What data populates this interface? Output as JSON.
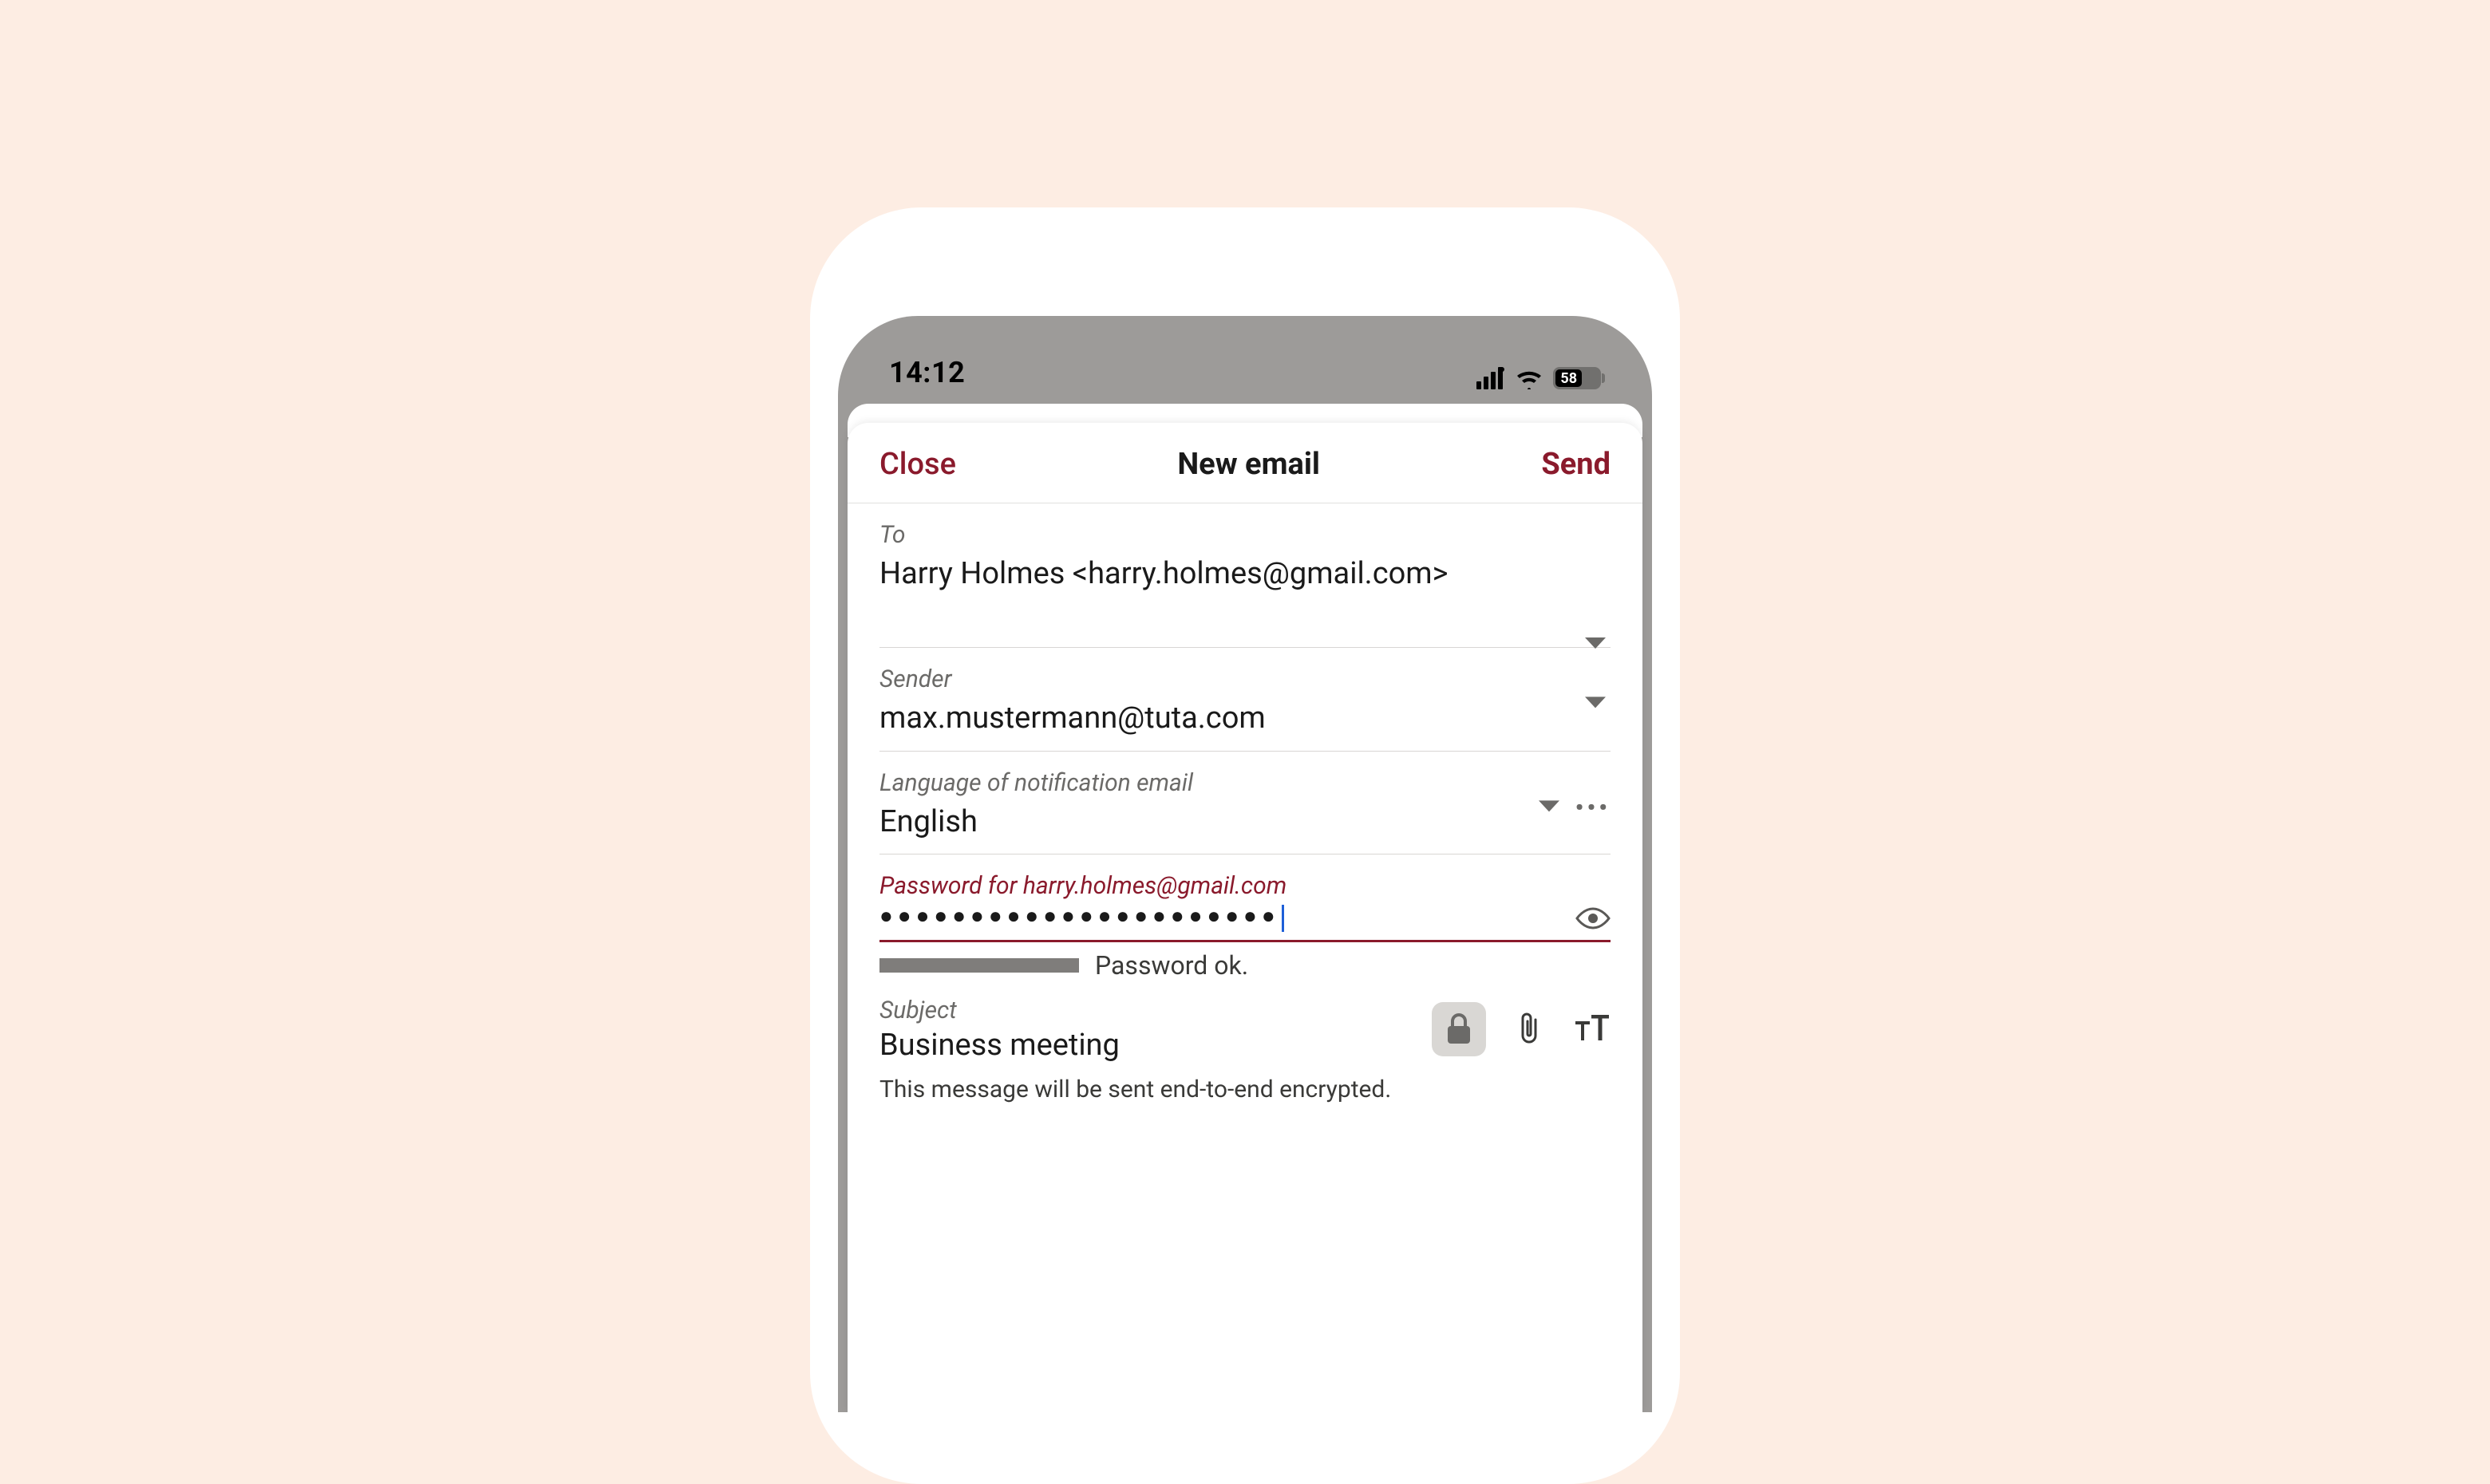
{
  "status": {
    "time": "14:12",
    "battery": "58"
  },
  "header": {
    "close": "Close",
    "title": "New email",
    "send": "Send"
  },
  "to": {
    "label": "To",
    "value": "Harry Holmes <harry.holmes@gmail.com>"
  },
  "sender": {
    "label": "Sender",
    "value": "max.mustermann@tuta.com"
  },
  "language": {
    "label": "Language of notification email",
    "value": "English"
  },
  "password": {
    "label": "Password for harry.holmes@gmail.com",
    "masked": "●●●●●●●●●●●●●●●●●●●●●●",
    "strength_text": "Password ok."
  },
  "subject": {
    "label": "Subject",
    "value": "Business meeting"
  },
  "encryption_note": "This message will be sent end-to-end encrypted."
}
